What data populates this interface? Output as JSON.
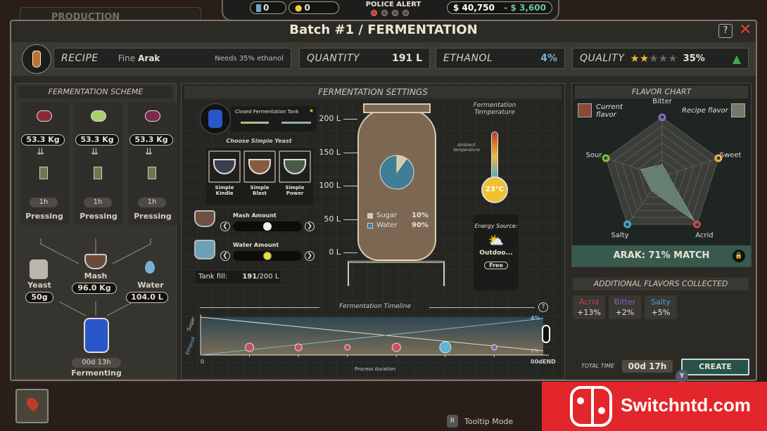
{
  "hud": {
    "batteries": "0",
    "bulbs": "0",
    "police_alert": "POLICE ALERT",
    "police_level": 1,
    "police_max": 4,
    "money": "$ 40,750",
    "money_change": "- $ 3,600"
  },
  "background_tab": "PRODUCTION",
  "window": {
    "title": "Batch #1 / FERMENTATION",
    "help": "?",
    "close": "✕"
  },
  "info": {
    "recipe_label": "RECIPE",
    "recipe_quality": "Fine",
    "recipe_name": "Arak",
    "recipe_note": "Needs 35% ethanol",
    "quantity_label": "QUANTITY",
    "quantity": "191 L",
    "ethanol_label": "ETHANOL",
    "ethanol": "4%",
    "quality_label": "QUALITY",
    "quality_stars": 2,
    "quality_max_stars": 5,
    "quality": "35%"
  },
  "scheme": {
    "title": "FERMENTATION SCHEME",
    "fruits": [
      {
        "icon": "grapes-icon",
        "amount": "53.3 Kg",
        "time": "1h",
        "process": "Pressing"
      },
      {
        "icon": "apple-icon",
        "amount": "53.3 Kg",
        "time": "1h",
        "process": "Pressing"
      },
      {
        "icon": "plum-icon",
        "amount": "53.3 Kg",
        "time": "1h",
        "process": "Pressing"
      }
    ],
    "yeast": {
      "label": "Yeast",
      "amount": "50g"
    },
    "mash": {
      "label": "Mash",
      "amount": "96.0 Kg"
    },
    "water": {
      "label": "Water",
      "amount": "104.0 L"
    },
    "ferment": {
      "time": "00d 13h",
      "label": "Fermenting"
    }
  },
  "settings": {
    "title": "FERMENTATION SETTINGS",
    "tank_name": "Closed Fermentation Tank",
    "yeast_title": "Choose Simple Yeast",
    "yeasts": [
      "Simple Kindle",
      "Simple Blast",
      "Simple Power"
    ],
    "mash_label": "Mash Amount",
    "mash_level": 0.5,
    "water_label": "Water Amount",
    "water_level": 0.5,
    "tank_fill_label": "Tank fill:",
    "tank_fill": "191",
    "tank_capacity": "/200 L",
    "scale": [
      "200 L",
      "150 L",
      "100 L",
      "50 L",
      "0 L"
    ],
    "mix": [
      {
        "name": "Sugar",
        "pct": "10%",
        "color": "#d6cba8",
        "value": 10
      },
      {
        "name": "Water",
        "pct": "90%",
        "color": "#3f7f96",
        "value": 90
      }
    ],
    "temp_title": "Fermentation Temperature",
    "ambient": "Ambient temperature",
    "temperature": "23°C",
    "energy_title": "Energy Source:",
    "energy_name": "Outdoo...",
    "energy_cost": "Free"
  },
  "timeline": {
    "title": "Fermentation Timeline",
    "help": "?",
    "y_sugar": "Sugar",
    "y_ethanol": "Ethanol",
    "x_start": "0",
    "x_end": "00dEND",
    "xlabel": "Process duration",
    "ethanol_end": "4%",
    "sugar_end": "1%",
    "events": [
      {
        "color": "#c2545e",
        "size": "large"
      },
      {
        "color": "#c2545e",
        "size": "medium"
      },
      {
        "color": "#c2545e",
        "size": "small"
      },
      {
        "color": "#c2545e",
        "size": "large"
      },
      {
        "color": "#5ab4d4",
        "size": "xlarge"
      },
      {
        "color": "#8a6bb0",
        "size": "small"
      }
    ]
  },
  "flavor": {
    "title": "FLAVOR CHART",
    "current_label": "Current flavor",
    "recipe_label": "Recipe flavor",
    "axes": [
      {
        "name": "Bitter",
        "color": "#8b6bc0"
      },
      {
        "name": "Sweet",
        "color": "#f2b43c"
      },
      {
        "name": "Acrid",
        "color": "#d04750"
      },
      {
        "name": "Salty",
        "color": "#4aa5d6"
      },
      {
        "name": "Sour",
        "color": "#7ec242"
      }
    ],
    "current": [
      0.2,
      0.1,
      0.92,
      0.3,
      0.38
    ],
    "recipe": [
      0.18,
      0.08,
      0.9,
      0.28,
      0.36
    ],
    "match": "ARAK: 71% MATCH"
  },
  "additional": {
    "title": "ADDITIONAL FLAVORS COLLECTED",
    "items": [
      {
        "name": "Acrid",
        "value": "+13%",
        "color": "#c4434c"
      },
      {
        "name": "Bitter",
        "value": "+2%",
        "color": "#8a62b8"
      },
      {
        "name": "Salty",
        "value": "+5%",
        "color": "#4a9fd2"
      }
    ]
  },
  "footer": {
    "total_time_label": "TOTAL TIME",
    "total_time": "00d 17h",
    "create": "CREATE",
    "create_key": "Y",
    "tooltip_key": "R",
    "tooltip": "Tooltip Mode"
  },
  "watermark": "Switchntd.com"
}
